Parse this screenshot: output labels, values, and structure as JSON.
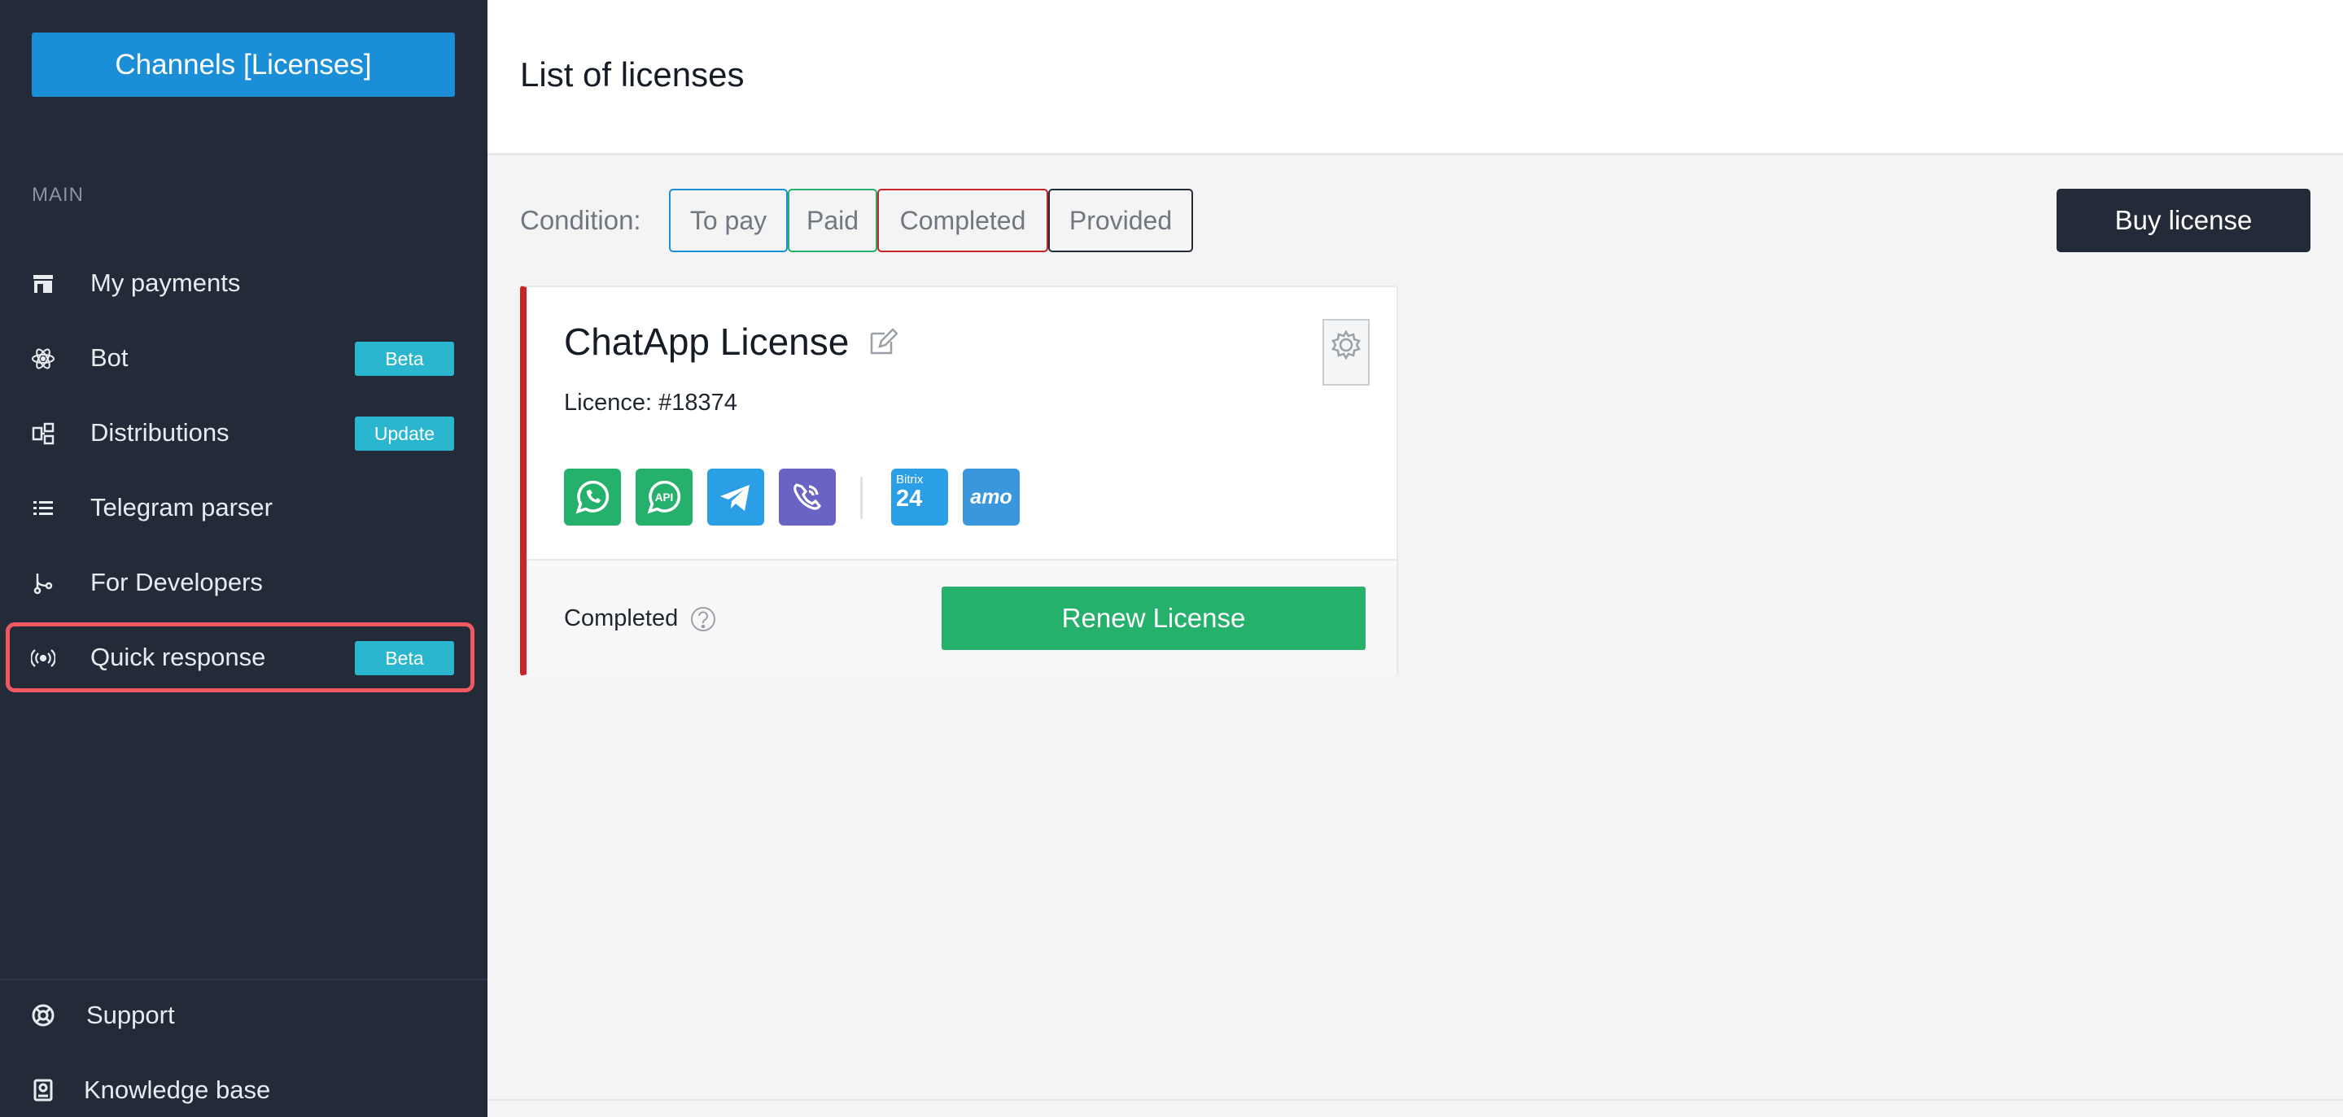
{
  "sidebar": {
    "header_button": "Channels [Licenses]",
    "section_label": "MAIN",
    "items": [
      {
        "label": "My payments",
        "icon": "store-icon",
        "badge": ""
      },
      {
        "label": "Bot",
        "icon": "atom-icon",
        "badge": "Beta"
      },
      {
        "label": "Distributions",
        "icon": "distribution-icon",
        "badge": "Update"
      },
      {
        "label": "Telegram parser",
        "icon": "list-icon",
        "badge": ""
      },
      {
        "label": "For Developers",
        "icon": "branch-icon",
        "badge": ""
      },
      {
        "label": "Quick response",
        "icon": "broadcast-icon",
        "badge": "Beta",
        "highlighted": true
      }
    ],
    "bottom_items": [
      {
        "label": "Support",
        "icon": "lifebuoy-icon"
      },
      {
        "label": "Knowledge base",
        "icon": "book-icon"
      }
    ]
  },
  "header": {
    "title": "List of licenses"
  },
  "filters": {
    "label": "Condition:",
    "options": [
      {
        "label": "To pay",
        "color": "#1a8fd8"
      },
      {
        "label": "Paid",
        "color": "#25b06c"
      },
      {
        "label": "Completed",
        "color": "#c8242a"
      },
      {
        "label": "Provided",
        "color": "#242b38"
      }
    ]
  },
  "buy_button": "Buy license",
  "license_card": {
    "title": "ChatApp License",
    "licence_number": "Licence: #18374",
    "channels": [
      {
        "name": "whatsapp-icon",
        "color": "#25b06c"
      },
      {
        "name": "whatsapp-api-icon",
        "color": "#25b06c",
        "text": "API"
      },
      {
        "name": "telegram-icon",
        "color": "#2a9fe6"
      },
      {
        "name": "viber-icon",
        "color": "#6964c4"
      }
    ],
    "integrations": [
      {
        "name": "bitrix24-icon",
        "color": "#2a9fe6",
        "text_top": "Bitrix",
        "text_main": "24"
      },
      {
        "name": "amocrm-icon",
        "color": "#3a97dc",
        "text": "amo"
      }
    ],
    "status": "Completed",
    "status_color": "#c8242a",
    "renew_button": "Renew License"
  }
}
